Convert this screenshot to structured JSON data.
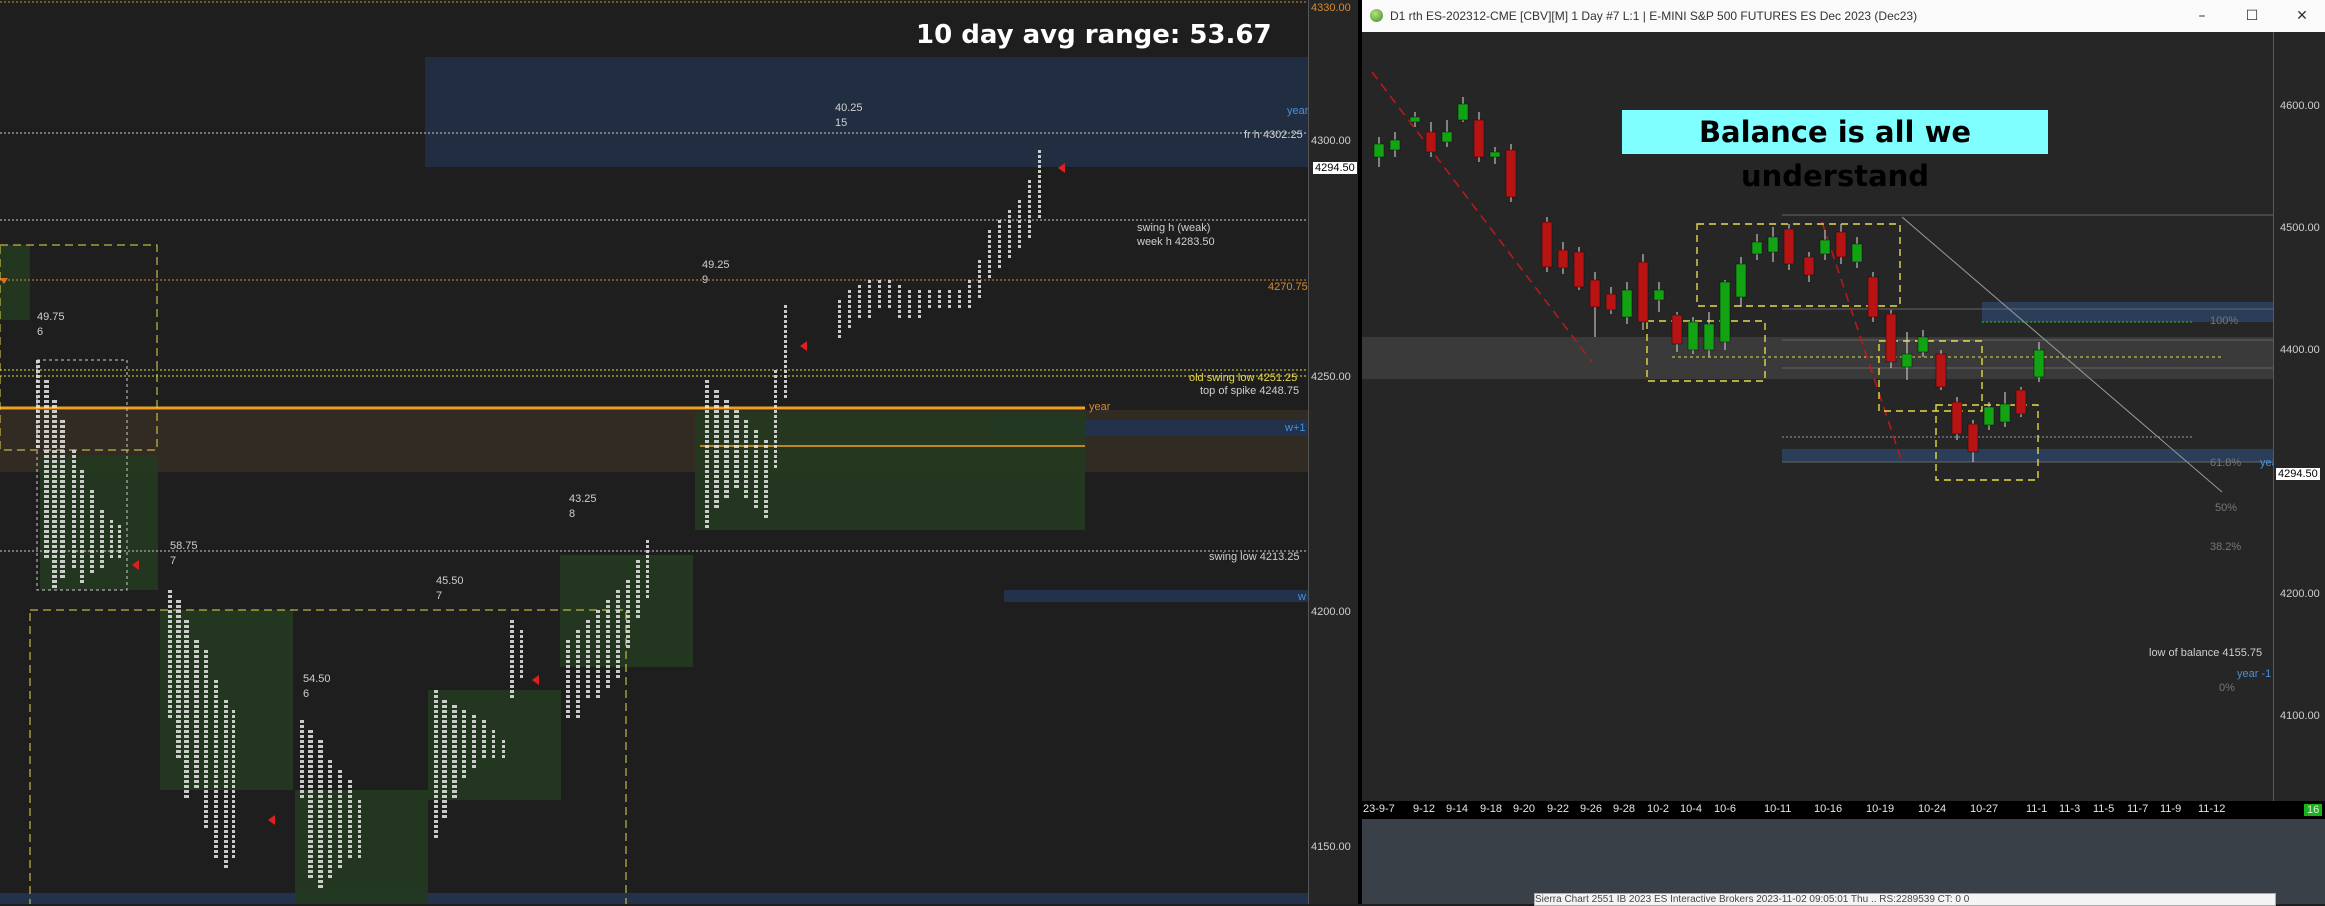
{
  "left_chart": {
    "title": "10 day avg range:  53.67",
    "price_labels": [
      "4330.00",
      "4300.00",
      "4250.00",
      "4200.00",
      "4150.00"
    ],
    "current_price": "4294.50",
    "levels": {
      "fr_h": "fr h  4302.25",
      "swing_h": "swing h (weak)",
      "week_h": "week h  4283.50",
      "l4270": "4270.75",
      "old_swing_low": "old swing low  4251.25",
      "top_of_spike": "top of spike  4248.75",
      "year": "year",
      "w_plus_1": "w+1",
      "swing_low": "swing low  4213.25",
      "w": "w",
      "year_top": "year"
    },
    "annotations": [
      {
        "range": "49.75",
        "count": "6"
      },
      {
        "range": "58.75",
        "count": "7"
      },
      {
        "range": "54.50",
        "count": "6"
      },
      {
        "range": "45.50",
        "count": "7"
      },
      {
        "range": "43.25",
        "count": "8"
      },
      {
        "range": "49.25",
        "count": "9"
      },
      {
        "range": "40.25",
        "count": "15"
      }
    ]
  },
  "right_window": {
    "title": "D1 rth ES-202312-CME [CBV][M]  1 Day  #7 L:1 | E-MINI S&P 500 FUTURES ES Dec 2023 (Dec23)",
    "minimize": "–",
    "maximize": "☐",
    "close": "✕",
    "banner": "Balance is all we understand",
    "price_labels": [
      "4600.00",
      "4500.00",
      "4400.00",
      "4300.00",
      "4200.00",
      "4100.00"
    ],
    "current_price": "4294.50",
    "fib_labels": [
      "100%",
      "61.8%",
      "50%",
      "38.2%",
      "0%"
    ],
    "low_of_balance": "low of balance  4155.75",
    "year_label": "year",
    "year_minus_label": "year -1",
    "dates": [
      "23-9-7",
      "9-12",
      "9-14",
      "9-18",
      "9-20",
      "9-22",
      "9-26",
      "9-28",
      "10-2",
      "10-4",
      "10-6",
      "10-11",
      "10-16",
      "10-19",
      "10-24",
      "10-27",
      "11-1",
      "11-3",
      "11-5",
      "11-7",
      "11-9",
      "11-12"
    ],
    "badge": "16"
  },
  "sierra_bar": "Sierra Chart 2551 IB 2023 ES Interactive Brokers  2023-11-02  09:05:01 Thu  ..  RS:2289539  CT: 0  0",
  "colors": {
    "up_candle": "#11a311",
    "down_candle": "#b81313",
    "banner_bg": "#7fffff",
    "level_orange": "#d98c2b",
    "level_blue": "#4a90d9"
  }
}
